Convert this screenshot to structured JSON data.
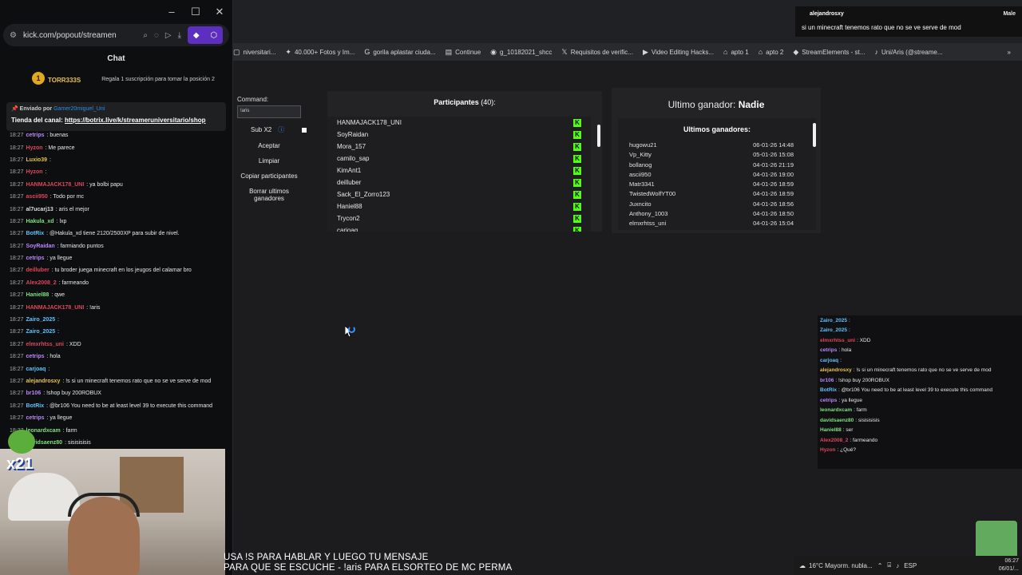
{
  "popout": {
    "url": "kick.com/popout/streamen",
    "chat_title": "Chat",
    "gifter": {
      "badge": "1",
      "name": "TORR333S",
      "count": "1",
      "message": "Regala 1 suscripción para tomar la posición 2"
    },
    "pinned": {
      "sent_by": "Enviado por",
      "sender": "Gamer20miguel_Uni",
      "store_label": "Tienda del canal:",
      "store_link": "https://botrix.live/k/streameruniversitario/shop"
    },
    "messages": [
      {
        "time": "18:27",
        "user": "cetrips",
        "color": "#bb86fc",
        "text": ": buenas"
      },
      {
        "time": "18:27",
        "user": "Hyzon",
        "color": "#e0455d",
        "text": ": Me parece"
      },
      {
        "time": "18:27",
        "user": "Luxio39",
        "color": "#e8c24a",
        "text": ":"
      },
      {
        "time": "18:27",
        "user": "Hyzon",
        "color": "#e0455d",
        "text": ":"
      },
      {
        "time": "18:27",
        "user": "HANMAJACK178_UNI",
        "color": "#e0455d",
        "text": ": ya bolbi papu"
      },
      {
        "time": "18:27",
        "user": "ascii950",
        "color": "#e0455d",
        "text": ": Todo por mc"
      },
      {
        "time": "18:27",
        "user": "al7ucarj13",
        "color": "#dddddd",
        "text": ": aris el mejor"
      },
      {
        "time": "18:27",
        "user": "Hakula_xd",
        "color": "#7ee07e",
        "text": ": lxp"
      },
      {
        "time": "18:27",
        "user": "BotRix",
        "color": "#5ec3ff",
        "text": ": @Hakula_xd tiene 2120/2500XP para subir de nivel."
      },
      {
        "time": "18:27",
        "user": "SoyRaidan",
        "color": "#bb86fc",
        "text": ": farmiando puntos"
      },
      {
        "time": "18:27",
        "user": "cetrips",
        "color": "#bb86fc",
        "text": ": ya llegue"
      },
      {
        "time": "18:27",
        "user": "deilluber",
        "color": "#e0455d",
        "text": ": tu broder juega minecraft en los jeugos del calamar bro"
      },
      {
        "time": "18:27",
        "user": "Alex2008_2",
        "color": "#e0455d",
        "text": ": farmeando"
      },
      {
        "time": "18:27",
        "user": "Haniel88",
        "color": "#7ee07e",
        "text": ": qwe"
      },
      {
        "time": "18:27",
        "user": "HANMAJACK178_UNI",
        "color": "#e0455d",
        "text": ": !aris"
      },
      {
        "time": "18:27",
        "user": "Zairo_2025",
        "color": "#5ec3ff",
        "text": ":"
      },
      {
        "time": "18:27",
        "user": "Zairo_2025",
        "color": "#5ec3ff",
        "text": ":"
      },
      {
        "time": "18:27",
        "user": "elmxrhtss_uni",
        "color": "#e0455d",
        "text": ": XDD"
      },
      {
        "time": "18:27",
        "user": "cetrips",
        "color": "#bb86fc",
        "text": ": hola"
      },
      {
        "time": "18:27",
        "user": "carjoaq",
        "color": "#5ec3ff",
        "text": ":"
      },
      {
        "time": "18:27",
        "user": "alejandrosxy",
        "color": "#e8c24a",
        "text": ": !s si un minecraft tenemos rato que no se ve serve de mod"
      },
      {
        "time": "18:27",
        "user": "br106",
        "color": "#bb86fc",
        "text": ": !shop buy 200ROBUX"
      },
      {
        "time": "18:27",
        "user": "BotRix",
        "color": "#5ec3ff",
        "text": ": @br106 You need to be at least level 39 to execute this command"
      },
      {
        "time": "18:27",
        "user": "cetrips",
        "color": "#bb86fc",
        "text": ": ya llegue"
      },
      {
        "time": "18:27",
        "user": "leonardxcam",
        "color": "#7ee07e",
        "text": ": farm"
      },
      {
        "time": "18:27",
        "user": "davidsaenz80",
        "color": "#7ee07e",
        "text": ": sisisisisis"
      }
    ]
  },
  "ticker": {
    "user": "alejandrosxy",
    "gender": "Male",
    "message": "si un minecraft tenemos rato que no se ve serve de mod"
  },
  "bookmarks": [
    {
      "icon": "bookmark-icon",
      "label": "niversitari..."
    },
    {
      "icon": "star-icon",
      "label": "40.000+ Fotos y Im..."
    },
    {
      "icon": "google-icon",
      "label": "gorila aplastar ciuda..."
    },
    {
      "icon": "doc-icon",
      "label": "Continue"
    },
    {
      "icon": "link-icon",
      "label": "g_10182021_shcc"
    },
    {
      "icon": "x-icon",
      "label": "Requisitos de verific..."
    },
    {
      "icon": "youtube-icon",
      "label": "Video Editing Hacks..."
    },
    {
      "icon": "airbnb-icon",
      "label": "apto 1"
    },
    {
      "icon": "airbnb-icon",
      "label": "apto 2"
    },
    {
      "icon": "se-icon",
      "label": "StreamElements - st..."
    },
    {
      "icon": "tiktok-icon",
      "label": "Uni/Aris (@streame..."
    }
  ],
  "controls": {
    "command_label": "Command:",
    "command_value": "!aris",
    "subx2_label": "Sub X2",
    "buttons": [
      "Aceptar",
      "Limpiar",
      "Copiar participantes",
      "Borrar ultimos ganadores"
    ]
  },
  "participants": {
    "title": "Participantes",
    "count": "(40):",
    "names": [
      "HANMAJACK178_UNI",
      "SoyRaidan",
      "Mora_157",
      "camilo_sap",
      "KimAnt1",
      "deilluber",
      "Sack_El_Zorro123",
      "Haniel88",
      "Trycon2",
      "carjoaq"
    ]
  },
  "winners": {
    "last_label": "Ultimo ganador:",
    "last_value": "Nadie",
    "list_title": "Ultimos ganadores:",
    "rows": [
      {
        "name": "hugowu21",
        "date": "06-01-26 14:48"
      },
      {
        "name": "Vp_Kitty",
        "date": "05-01-26 15:08"
      },
      {
        "name": "bollanog",
        "date": "04-01-26 21:19"
      },
      {
        "name": "ascii950",
        "date": "04-01-26 19:00"
      },
      {
        "name": "Matr3341",
        "date": "04-01-26 18:59"
      },
      {
        "name": "TwistedWolfYT00",
        "date": "04-01-26 18:59"
      },
      {
        "name": "Juxncito",
        "date": "04-01-26 18:56"
      },
      {
        "name": "Anthony_1003",
        "date": "04-01-26 18:50"
      },
      {
        "name": "elmxrhtss_uni",
        "date": "04-01-26 15:04"
      }
    ]
  },
  "right_chat": [
    {
      "user": "Zairo_2025",
      "color": "#5ec3ff",
      "text": ":"
    },
    {
      "user": "Zairo_2025",
      "color": "#5ec3ff",
      "text": ":"
    },
    {
      "user": "elmxrhtss_uni",
      "color": "#e0455d",
      "text": ": XDD"
    },
    {
      "user": "cetrips",
      "color": "#bb86fc",
      "text": ": hola"
    },
    {
      "user": "carjoaq",
      "color": "#5ec3ff",
      "text": ":"
    },
    {
      "user": "alejandrosxy",
      "color": "#e8c24a",
      "text": ": !s si un minecraft tenemos rato que no se ve serve de mod"
    },
    {
      "user": "br106",
      "color": "#bb86fc",
      "text": ": !shop buy 200ROBUX"
    },
    {
      "user": "BotRix",
      "color": "#5ec3ff",
      "text": ": @br106 You need to be at least level 39 to execute this command"
    },
    {
      "user": "cetrips",
      "color": "#bb86fc",
      "text": ": ya llegue"
    },
    {
      "user": "leonardxcam",
      "color": "#7ee07e",
      "text": ": farm"
    },
    {
      "user": "davidsaenz80",
      "color": "#7ee07e",
      "text": ": sisisisisis"
    },
    {
      "user": "Haniel88",
      "color": "#7ee07e",
      "text": ": ser"
    },
    {
      "user": "Alex2008_2",
      "color": "#e0455d",
      "text": ": farmeando"
    },
    {
      "user": "Hyzon",
      "color": "#e0455d",
      "text": ": ¿Qué?"
    }
  ],
  "overlay": {
    "webcam_tag": "x21",
    "subtitle_line1": "USA !S PARA HABLAR Y LUEGO TU MENSAJE",
    "subtitle_line2": "PARA QUE SE ESCUCHE - !aris PARA ELSORTEO DE MC PERMA"
  },
  "taskbar": {
    "weather": "16°C  Mayorm. nubla...",
    "lang": "ESP",
    "time": "06:27",
    "date": "06/01/..."
  }
}
